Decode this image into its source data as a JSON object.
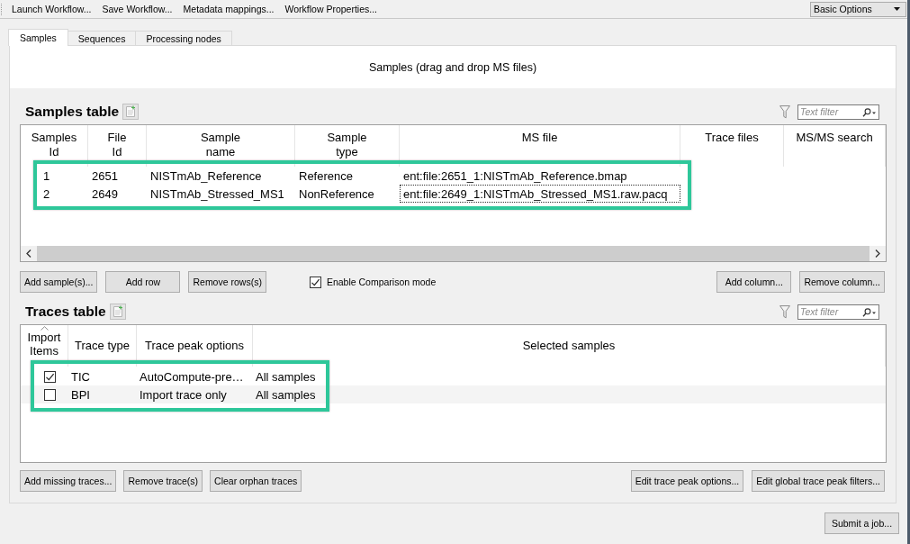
{
  "toolbar": {
    "actions": [
      "Launch Workflow...",
      "Save Workflow...",
      "Metadata mappings...",
      "Workflow Properties..."
    ],
    "mode_dropdown": {
      "value": "Basic Options"
    }
  },
  "tabs": [
    {
      "label": "Samples",
      "selected": true
    },
    {
      "label": "Sequences",
      "selected": false
    },
    {
      "label": "Processing nodes",
      "selected": false
    }
  ],
  "drop_zone": {
    "text": "Samples (drag and drop MS files)"
  },
  "samples_table": {
    "title": "Samples table",
    "filter": {
      "placeholder": "Text filter"
    },
    "highlighted": true,
    "columns": [
      "Samples\nId",
      "File\nId",
      "Sample\nname",
      "Sample\ntype",
      "MS file",
      "Trace files",
      "MS/MS search"
    ],
    "rows": [
      {
        "cells": [
          {
            "text": "1",
            "focused": false
          },
          {
            "text": "2651",
            "focused": false
          },
          {
            "text": "NISTmAb_Reference",
            "focused": false
          },
          {
            "text": "Reference",
            "focused": false
          },
          {
            "text": "ent:file:2651_1:NISTmAb_Reference.bmap",
            "focused": false
          }
        ]
      },
      {
        "cells": [
          {
            "text": "2",
            "focused": false
          },
          {
            "text": "2649",
            "focused": false
          },
          {
            "text": "NISTmAb_Stressed_MS1",
            "focused": false
          },
          {
            "text": "NonReference",
            "focused": false
          },
          {
            "text": "ent:file:2649_1:NISTmAb_Stressed_MS1.raw.pacq",
            "focused": true
          }
        ]
      }
    ]
  },
  "samples_buttons": {
    "left": [
      "Add sample(s)...",
      "Add row",
      "Remove rows(s)"
    ],
    "comparison_mode": {
      "label": "Enable Comparison mode",
      "checked": true
    },
    "right": [
      "Add column...",
      "Remove column..."
    ]
  },
  "traces_table": {
    "title": "Traces table",
    "filter": {
      "placeholder": "Text filter"
    },
    "highlighted": true,
    "columns": [
      {
        "label": "Import\nItems",
        "sorted": true
      },
      {
        "label": "Trace type",
        "sorted": false
      },
      {
        "label": "Trace peak options",
        "sorted": false
      },
      {
        "label": "Selected samples",
        "sorted": false
      }
    ],
    "rows": [
      {
        "cells": [
          {
            "kind": "checkbox",
            "checked": true
          },
          {
            "kind": "text",
            "text": "TIC"
          },
          {
            "kind": "text",
            "text": "AutoCompute-pre…"
          },
          {
            "kind": "text",
            "text": "All samples"
          }
        ]
      },
      {
        "cells": [
          {
            "kind": "checkbox",
            "checked": false
          },
          {
            "kind": "text",
            "text": "BPI"
          },
          {
            "kind": "text",
            "text": "Import trace only"
          },
          {
            "kind": "text",
            "text": "All samples"
          }
        ]
      }
    ]
  },
  "traces_buttons": {
    "left": [
      "Add missing traces...",
      "Remove trace(s)",
      "Clear orphan traces"
    ],
    "right": [
      "Edit trace peak options...",
      "Edit global trace peak filters..."
    ]
  },
  "submit_button": {
    "label": "Submit a job..."
  }
}
